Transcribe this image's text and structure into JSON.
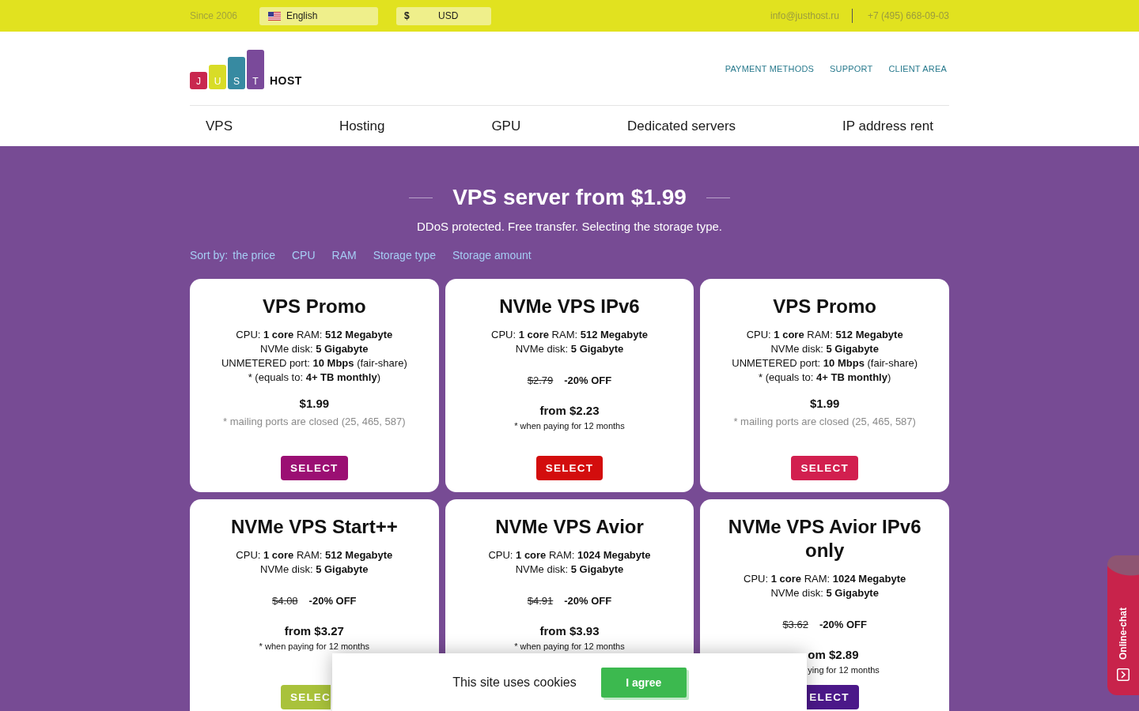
{
  "top_bar": {
    "since": "Since 2006",
    "language": {
      "label": "English"
    },
    "currency": {
      "symbol": "$",
      "code": "USD"
    },
    "email": "info@justhost.ru",
    "phone": "+7 (495) 668-09-03"
  },
  "header": {
    "logo": {
      "letters": [
        "J",
        "U",
        "S",
        "T"
      ],
      "word": "HOST"
    },
    "links": [
      "PAYMENT METHODS",
      "SUPPORT",
      "CLIENT AREA"
    ]
  },
  "main_nav": [
    "VPS",
    "Hosting",
    "GPU",
    "Dedicated servers",
    "IP address rent"
  ],
  "hero": {
    "title": "VPS server from $1.99",
    "subtitle": "DDoS protected. Free transfer. Selecting the storage type."
  },
  "sort": {
    "label": "Sort by:",
    "options": [
      "the price",
      "CPU",
      "RAM",
      "Storage type",
      "Storage amount"
    ]
  },
  "plans": [
    {
      "kind": "flat",
      "title": "VPS Promo",
      "specs": [
        "CPU: **1 core** RAM: **512 Megabyte**",
        "NVMe disk: **5 Gigabyte**",
        "UNMETERED port: **10 Mbps** (fair-share)",
        "* (equals to: **4+ TB monthly**)"
      ],
      "price": "$1.99",
      "note": "* mailing ports are closed (25, 465, 587)",
      "button": "SELECT",
      "color": "#9b0f73"
    },
    {
      "kind": "discount",
      "title": "NVMe VPS IPv6",
      "specs": [
        "CPU: **1 core** RAM: **512 Megabyte**",
        "NVMe disk: **5 Gigabyte**"
      ],
      "old_price": "$2.79",
      "discount": "-20% OFF",
      "price": "from $2.23",
      "note": "* when paying for 12 months",
      "button": "SELECT",
      "color": "#d30d0d"
    },
    {
      "kind": "flat",
      "title": "VPS Promo",
      "specs": [
        "CPU: **1 core** RAM: **512 Megabyte**",
        "NVMe disk: **5 Gigabyte**",
        "UNMETERED port: **10 Mbps** (fair-share)",
        "* (equals to: **4+ TB monthly**)"
      ],
      "price": "$1.99",
      "note": "* mailing ports are closed (25, 465, 587)",
      "button": "SELECT",
      "color": "#d21f4f"
    },
    {
      "kind": "discount",
      "title": "NVMe VPS Start++",
      "specs": [
        "CPU: **1 core** RAM: **512 Megabyte**",
        "NVMe disk: **5 Gigabyte**"
      ],
      "old_price": "$4.08",
      "discount": "-20% OFF",
      "price": "from $3.27",
      "note": "* when paying for 12 months",
      "button": "SELEC",
      "color": "#a9c23b"
    },
    {
      "kind": "discount",
      "title": "NVMe VPS Avior",
      "specs": [
        "CPU: **1 core** RAM: **1024 Megabyte**",
        "NVMe disk: **5 Gigabyte**"
      ],
      "old_price": "$4.91",
      "discount": "-20% OFF",
      "price": "from $3.93",
      "note": "* when paying for 12 months"
    },
    {
      "kind": "discount",
      "title": "NVMe VPS Avior IPv6 only",
      "specs": [
        "CPU: **1 core** RAM: **1024 Megabyte**",
        "NVMe disk: **5 Gigabyte**"
      ],
      "old_price": "$3.62",
      "discount": "-20% OFF",
      "price": "om $2.89",
      "note": "ying for 12 months",
      "button": "ELECT",
      "color": "#4b1889"
    }
  ],
  "cookie_banner": {
    "text": "This site uses cookies",
    "button": "I agree"
  },
  "chat_widget": {
    "label": "Online-chat"
  }
}
